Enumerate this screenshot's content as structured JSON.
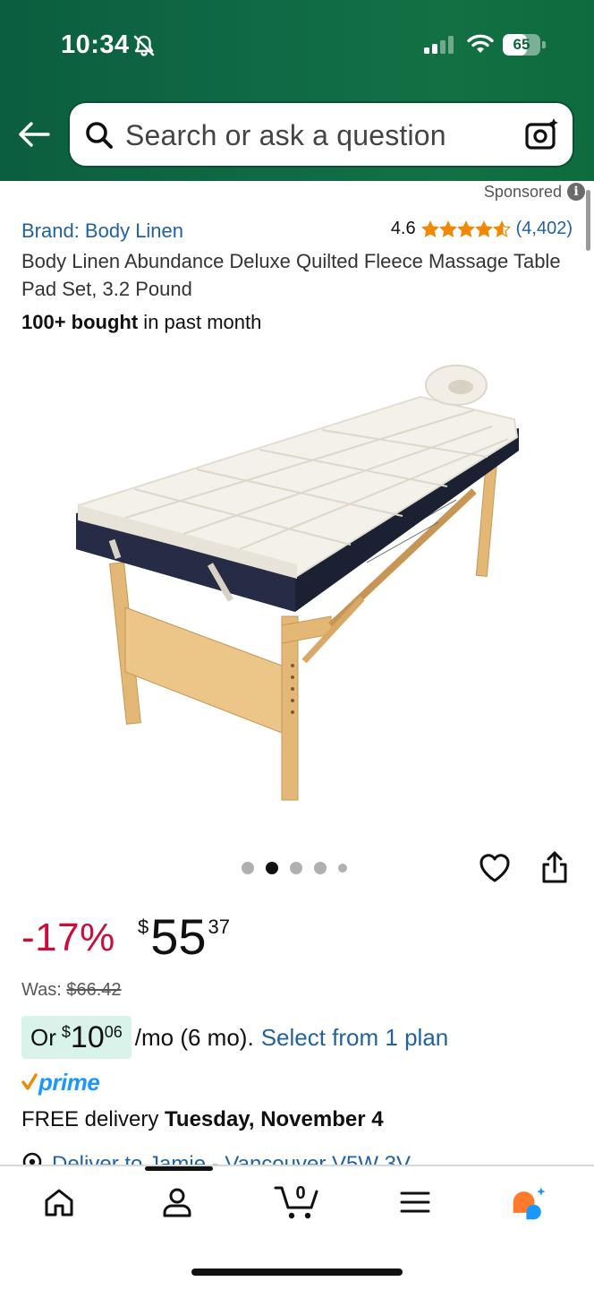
{
  "status_bar": {
    "time": "10:34",
    "battery": "65",
    "battery_level": 0.65
  },
  "search": {
    "placeholder": "Search or ask a question"
  },
  "sponsored_label": "Sponsored",
  "product": {
    "brand": "Brand: Body Linen",
    "rating": "4.6",
    "stars": 4.6,
    "rating_count": "(4,402)",
    "title": "Body Linen Abundance Deluxe Quilted Fleece Massage Table Pad Set, 3.2 Pound",
    "bought_bold": "100+ bought",
    "bought_rest": " in past month",
    "image_count": 5,
    "active_image": 2
  },
  "price": {
    "discount": "-17%",
    "currency": "$",
    "whole": "55",
    "fraction": "37",
    "was_label": "Was: ",
    "was_price": "$66.42"
  },
  "installment": {
    "prefix": "Or",
    "currency": "$",
    "whole": "10",
    "fraction": "06",
    "rest": "/mo (6 mo).",
    "link": "Select from 1 plan"
  },
  "prime": {
    "label": "prime",
    "color": "#1a98ff",
    "check_color": "#f08804"
  },
  "delivery": {
    "prefix": "FREE delivery ",
    "date": "Tuesday, November 4"
  },
  "deliver_to": "Deliver to Jamie - Vancouver V5W 3V",
  "bottom_nav": {
    "items": [
      "home-icon",
      "account-icon",
      "cart-icon",
      "menu-icon",
      "rufus-icon"
    ],
    "cart_count": "0"
  },
  "colors": {
    "header_green": "#0f6a45",
    "link_blue": "#2162a1",
    "deal_red": "#cc0c39",
    "star_orange": "#f08804"
  }
}
